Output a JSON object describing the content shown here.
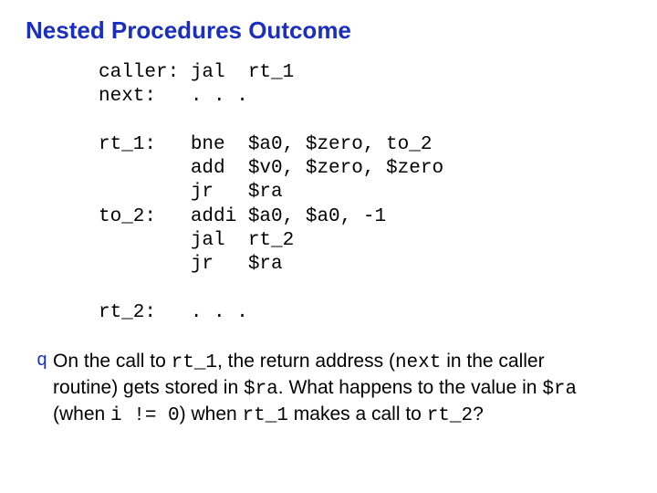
{
  "title": "Nested Procedures Outcome",
  "code": {
    "l01": "caller: jal  rt_1",
    "l02": "next:   . . .",
    "l03": "",
    "l04": "rt_1:   bne  $a0, $zero, to_2",
    "l05": "        add  $v0, $zero, $zero",
    "l06": "        jr   $ra",
    "l07": "to_2:   addi $a0, $a0, -1",
    "l08": "        jal  rt_2",
    "l09": "        jr   $ra",
    "l10": "",
    "l11": "rt_2:   . . ."
  },
  "bullet_glyph": "q",
  "para": {
    "t1": "On the call to ",
    "c1": "rt_1",
    "t2": ", the return address (",
    "c2": "next",
    "t3": " in the caller routine) gets stored in ",
    "c3": "$ra",
    "t4": ".  What happens to the value in ",
    "c4": "$ra",
    "t5": " (when ",
    "c5": "i != 0",
    "t6": ") when ",
    "c6": "rt_1",
    "t7": " makes a call to ",
    "c7": "rt_2",
    "t8": "?"
  }
}
